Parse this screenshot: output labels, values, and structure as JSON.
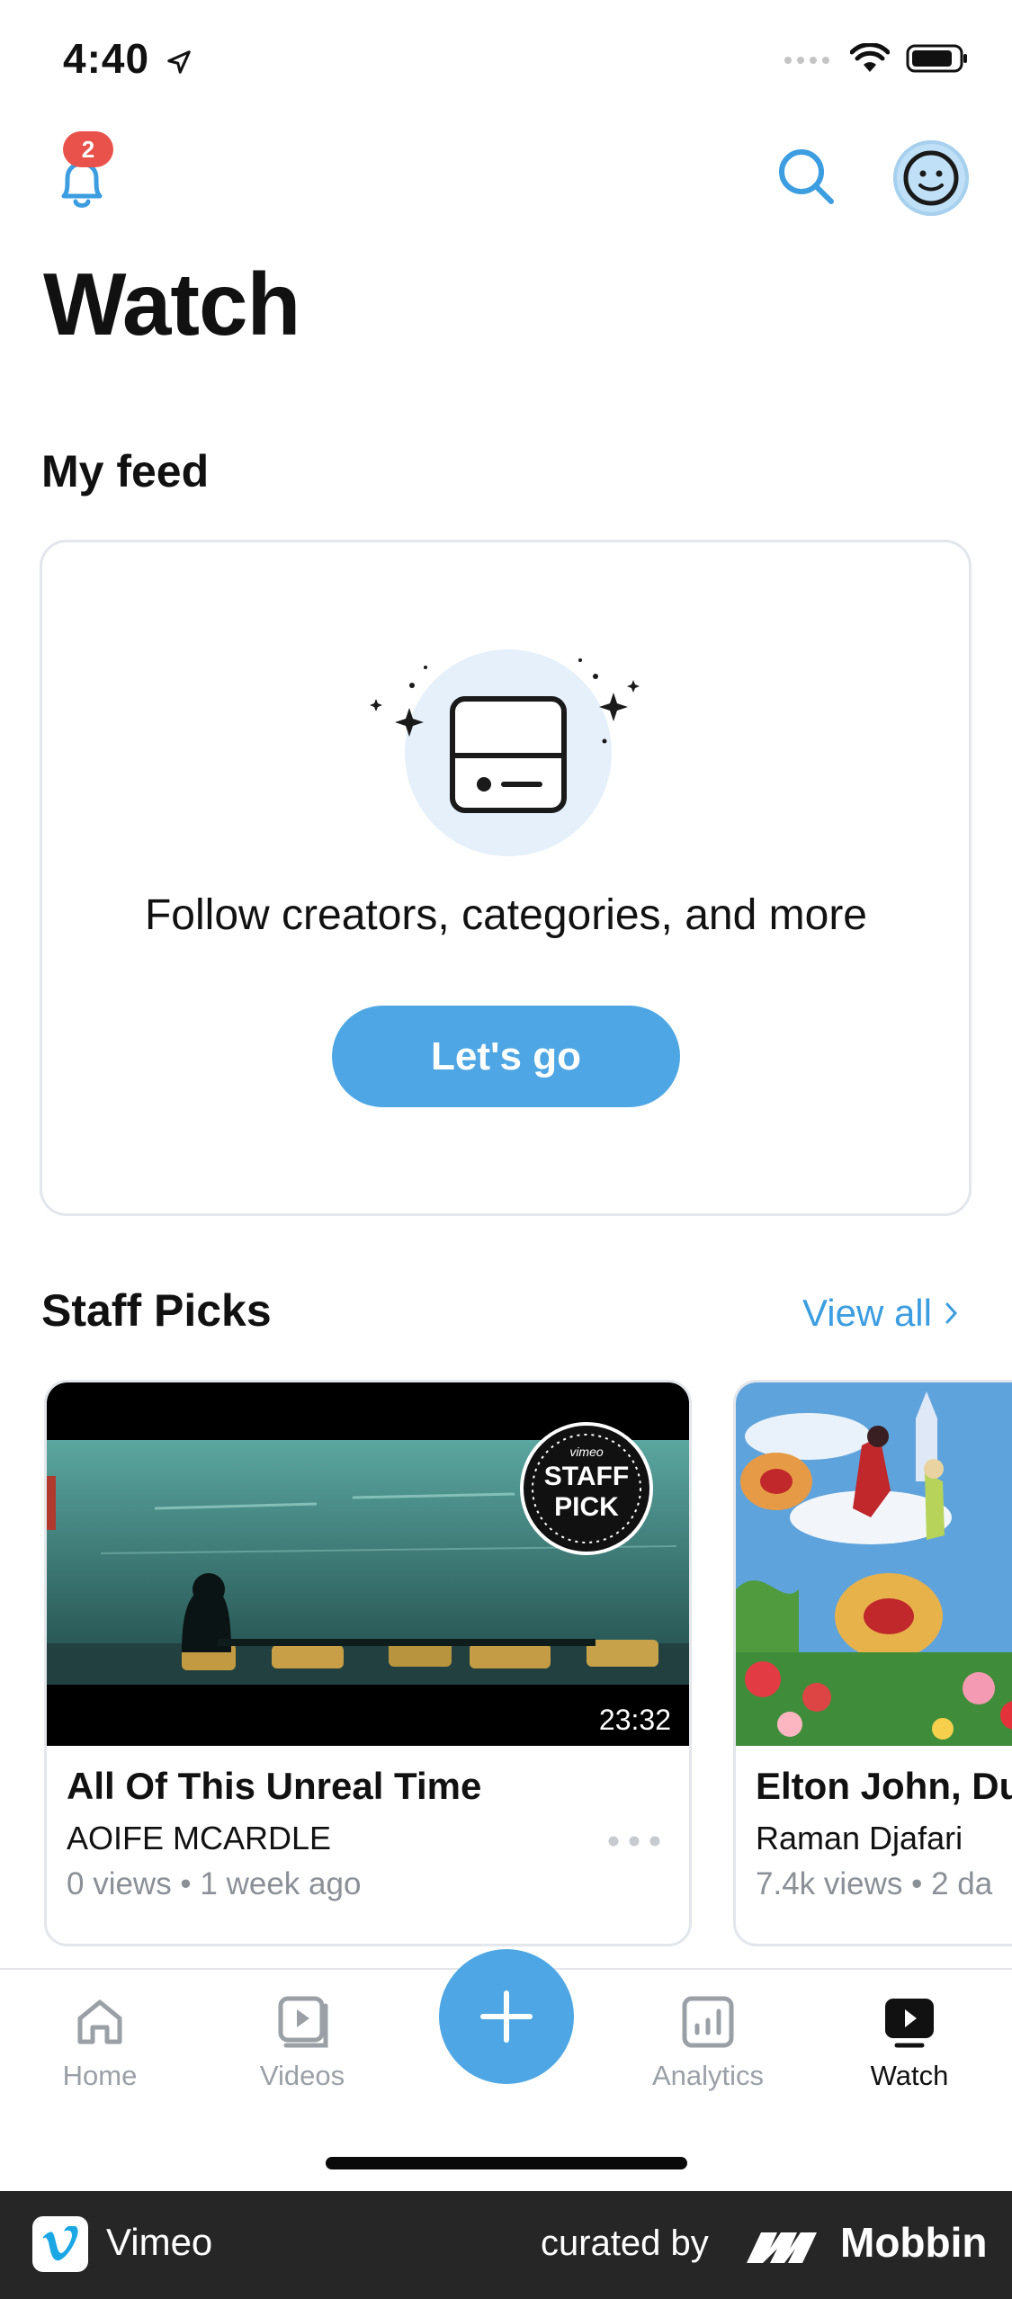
{
  "status_bar": {
    "time": "4:40"
  },
  "header": {
    "notification_count": "2",
    "title": "Watch"
  },
  "my_feed": {
    "heading": "My feed",
    "message": "Follow creators, categories, and more",
    "cta_label": "Let's go"
  },
  "staff_picks": {
    "heading": "Staff Picks",
    "view_all_label": "View all",
    "badge_text": [
      "vimeo",
      "STAFF",
      "PICK"
    ],
    "videos": [
      {
        "title": "All Of This Unreal Time",
        "creator": "AOIFE MCARDLE",
        "meta": "0 views • 1 week ago",
        "duration": "23:32"
      },
      {
        "title": "Elton John, Du",
        "creator": "Raman Djafari",
        "meta": "7.4k views • 2 da"
      }
    ]
  },
  "tab_bar": {
    "tabs": [
      {
        "label": "Home",
        "icon": "home-icon"
      },
      {
        "label": "Videos",
        "icon": "videos-icon"
      },
      {
        "label": "Analytics",
        "icon": "analytics-icon"
      },
      {
        "label": "Watch",
        "icon": "watch-icon",
        "active": true
      }
    ],
    "add_icon": "plus-icon"
  },
  "footer": {
    "app_name": "Vimeo",
    "curated_by": "curated by",
    "brand": "Mobbin"
  },
  "colors": {
    "accent": "#4ea7e4",
    "badge": "#e8524a",
    "footer_bg": "#262626"
  }
}
